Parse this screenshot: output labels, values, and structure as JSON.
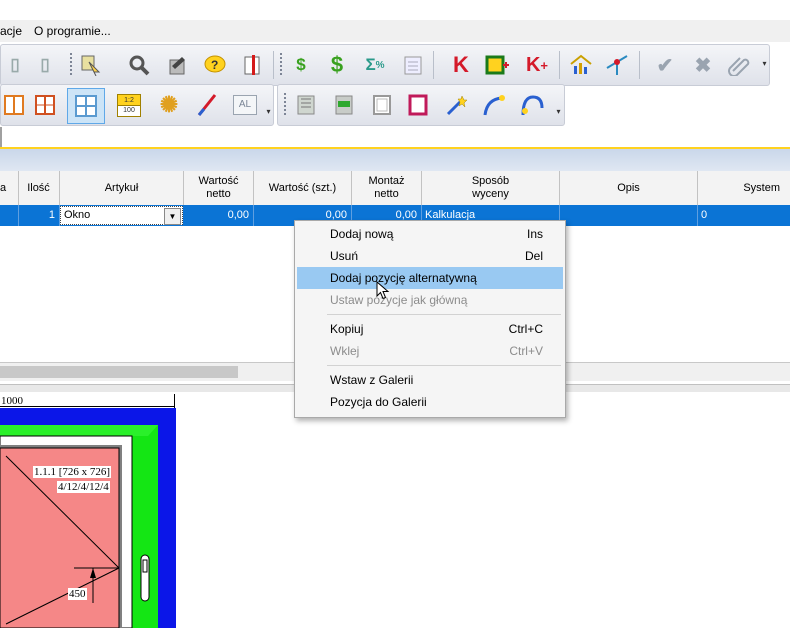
{
  "menubar": {
    "items": [
      "acje",
      "O programie..."
    ]
  },
  "toolbar": {
    "row1_icons": [
      "doc-icon",
      "doc-icon",
      "cursor-icon",
      "search-icon",
      "edit-icon",
      "help-icon",
      "report-icon",
      "dollar-icon",
      "dollar-multi-icon",
      "sigma-percent-icon",
      "notes-icon",
      "k-icon",
      "frame-add-icon",
      "k-plus-icon",
      "chart-house-icon",
      "split-icon",
      "check-icon",
      "x-icon",
      "attach-icon"
    ],
    "row2_icons": [
      "frame-split-icon",
      "frame-split2-icon",
      "frame-cross-icon",
      "scale-icon",
      "gear-icon",
      "line-icon",
      "al-icon",
      "texture-icon",
      "green-glass-icon",
      "frame-icon",
      "red-frame-icon",
      "wand-icon",
      "arc-icon",
      "arch-icon"
    ],
    "scale_label": "1:2",
    "scale_sub": "100",
    "al_label": "AL"
  },
  "grid": {
    "headers": [
      "a",
      "Ilość",
      "Artykuł",
      "Wartość\nnetto",
      "Wartość (szt.)",
      "Montaż\nnetto",
      "Sposób\nwyceny",
      "Opis",
      "System"
    ],
    "row": {
      "qty": "1",
      "article": "Okno",
      "value_net": "0,00",
      "value_unit": "0,00",
      "assembly": "0,00",
      "pricing": "Kalkulacja",
      "system": "0"
    }
  },
  "context_menu": {
    "items": [
      {
        "label": "Dodaj nową",
        "shortcut": "Ins"
      },
      {
        "label": "Usuń",
        "shortcut": "Del"
      },
      {
        "label": "Dodaj pozycję alternatywną",
        "shortcut": ""
      },
      {
        "label": "Ustaw pozycje jak główną",
        "shortcut": ""
      },
      {
        "label": "Kopiuj",
        "shortcut": "Ctrl+C"
      },
      {
        "label": "Wklej",
        "shortcut": "Ctrl+V"
      },
      {
        "label": "Wstaw z Galerii",
        "shortcut": ""
      },
      {
        "label": "Pozycja do Galerii",
        "shortcut": ""
      }
    ]
  },
  "drawing": {
    "ruler_label": "1000",
    "sash_label": "1.1.1 [726 x 726]",
    "glass_label": "4/12/4/12/4",
    "dimension_label": "450"
  },
  "colors": {
    "selection": "#0b74d5",
    "frame_blue": "#0b16e8",
    "frame_green": "#14e614",
    "glass_red": "#f58787",
    "menu_highlight": "#99c9f2"
  }
}
